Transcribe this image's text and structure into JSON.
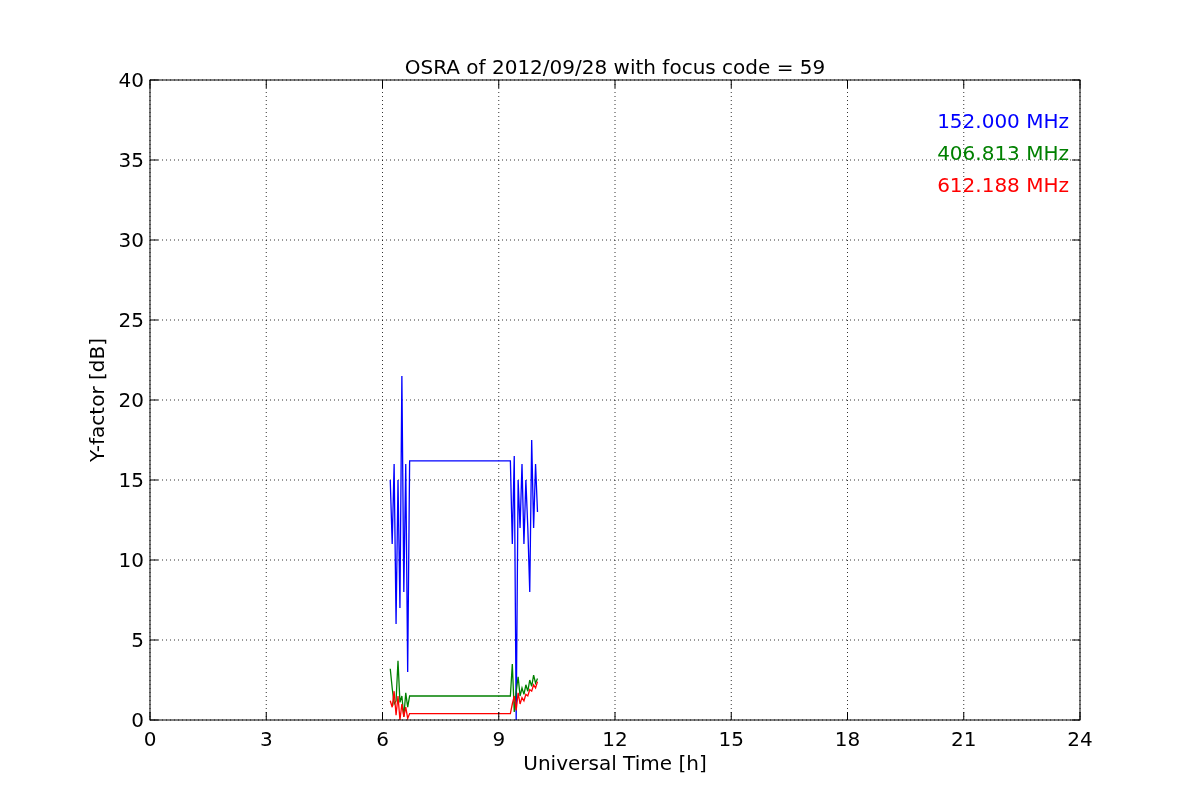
{
  "chart_data": {
    "type": "line",
    "title": "OSRA of 2012/09/28 with focus code = 59",
    "xlabel": "Universal Time [h]",
    "ylabel": "Y-factor [dB]",
    "x": [
      6.2,
      6.25,
      6.3,
      6.35,
      6.4,
      6.45,
      6.5,
      6.55,
      6.6,
      6.65,
      6.7,
      9.3,
      9.35,
      9.4,
      9.45,
      9.5,
      9.55,
      9.6,
      9.65,
      9.7,
      9.75,
      9.8,
      9.85,
      9.9,
      9.95,
      10.0
    ],
    "series": [
      {
        "name": "152.000 MHz",
        "color": "#0000ff",
        "values": [
          15,
          11,
          16,
          6,
          15,
          7,
          21.5,
          8,
          16,
          3,
          16.2,
          16.2,
          11,
          16.5,
          0,
          15,
          12,
          16,
          11,
          15,
          12,
          8,
          17.5,
          12,
          16,
          13
        ]
      },
      {
        "name": "406.813 MHz",
        "color": "#008000",
        "values": [
          3.2,
          2,
          1,
          1.2,
          3.7,
          1.1,
          1.5,
          0.2,
          1.7,
          0.8,
          1.5,
          1.5,
          3.5,
          0.5,
          1.8,
          2.7,
          1.5,
          2,
          1.6,
          2.2,
          1.8,
          2.5,
          2.1,
          2.8,
          2.3,
          2.6
        ]
      },
      {
        "name": "612.188 MHz",
        "color": "#ff0000",
        "values": [
          1.2,
          0.8,
          1.8,
          0.3,
          1.5,
          0,
          1,
          0.2,
          0.8,
          0.1,
          0.4,
          0.4,
          1,
          1.5,
          0.6,
          1.7,
          1,
          1.4,
          1.2,
          1.6,
          1.5,
          1.9,
          1.8,
          2.2,
          2,
          2.4
        ]
      }
    ],
    "grid": true,
    "xlim": [
      0,
      24
    ],
    "ylim": [
      0,
      40
    ],
    "xticks": [
      0,
      3,
      6,
      9,
      12,
      15,
      18,
      21,
      24
    ],
    "yticks": [
      0,
      5,
      10,
      15,
      20,
      25,
      30,
      35,
      40
    ]
  }
}
